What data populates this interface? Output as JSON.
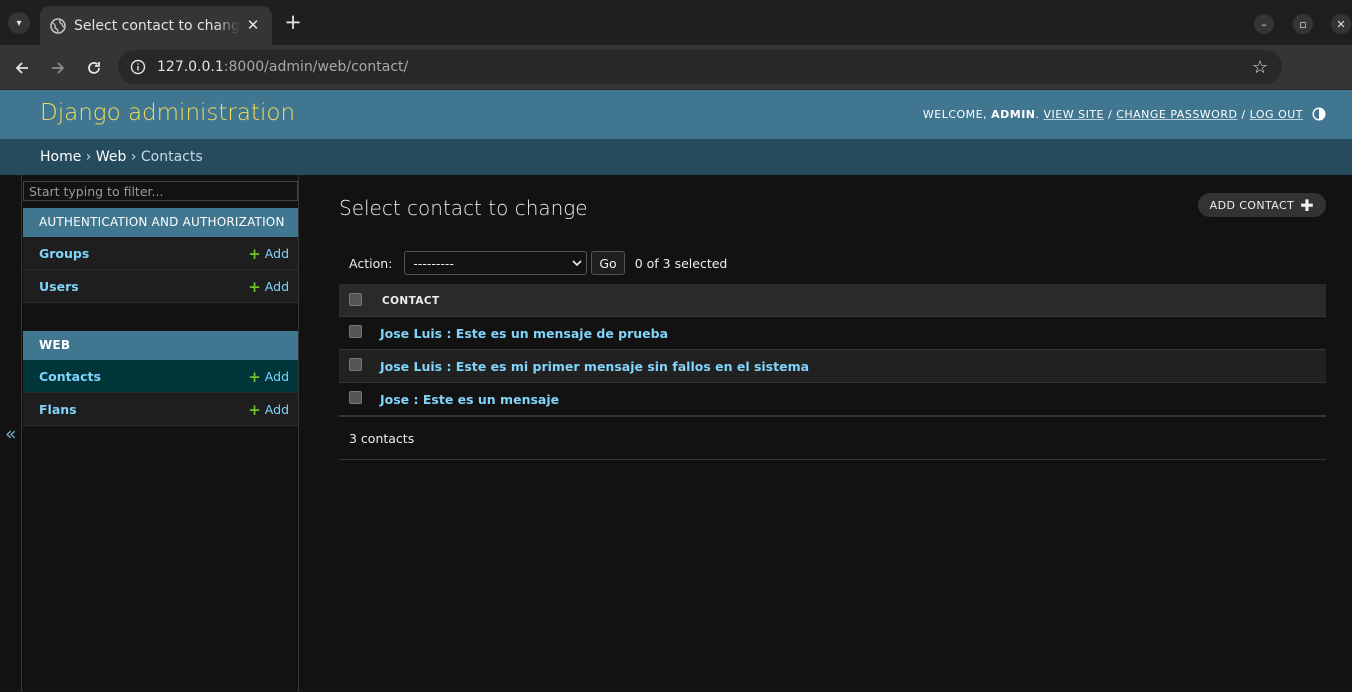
{
  "browser": {
    "tab_title": "Select contact to change | Django site admin",
    "url_host": "127.0.0.1",
    "url_rest": ":8000/admin/web/contact/"
  },
  "header": {
    "branding": "Django administration",
    "welcome": "WELCOME,",
    "username": "ADMIN",
    "view_site": "VIEW SITE",
    "change_password": "CHANGE PASSWORD",
    "log_out": "LOG OUT"
  },
  "breadcrumbs": {
    "home": "Home",
    "sep": " › ",
    "app": "Web",
    "current": "Contacts"
  },
  "sidebar": {
    "filter_placeholder": "Start typing to filter...",
    "modules": [
      {
        "caption": "AUTHENTICATION AND AUTHORIZATION",
        "models": [
          {
            "name": "Groups",
            "add": "Add"
          },
          {
            "name": "Users",
            "add": "Add"
          }
        ]
      },
      {
        "caption": "WEB",
        "models": [
          {
            "name": "Contacts",
            "add": "Add",
            "current": true
          },
          {
            "name": "Flans",
            "add": "Add"
          }
        ]
      }
    ],
    "collapse_glyph": "«"
  },
  "content": {
    "title": "Select contact to change",
    "add_button": "ADD CONTACT",
    "action_label": "Action:",
    "action_selected": "---------",
    "go_label": "Go",
    "selected_count": "0 of 3 selected",
    "column_header": "CONTACT",
    "rows": [
      "Jose Luis : Este es un mensaje de prueba",
      "Jose Luis : Este es mi primer mensaje sin fallos en el sistema",
      "Jose : Este es un mensaje"
    ],
    "paginator": "3 contacts"
  },
  "colors": {
    "header_bg": "#417690",
    "breadcrumb_bg": "#264b5d",
    "branding": "#f5dd5d",
    "link": "#81d4fa",
    "add_plus": "#70bf2b",
    "current_row": "#00363a"
  }
}
